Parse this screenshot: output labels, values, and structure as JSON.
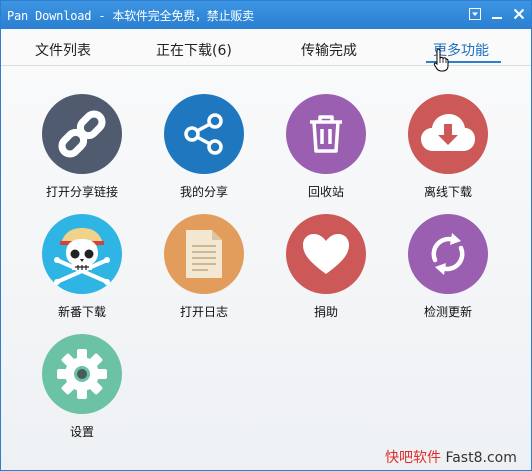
{
  "window": {
    "title": "Pan Download - 本软件完全免费，禁止贩卖"
  },
  "tabs": [
    {
      "label": "文件列表",
      "active": false
    },
    {
      "label": "正在下载(6)",
      "active": false
    },
    {
      "label": "传输完成",
      "active": false
    },
    {
      "label": "更多功能",
      "active": true
    }
  ],
  "features": [
    {
      "label": "打开分享链接",
      "icon": "link-icon",
      "color": "#505b70"
    },
    {
      "label": "我的分享",
      "icon": "share-icon",
      "color": "#1f78bf"
    },
    {
      "label": "回收站",
      "icon": "trash-icon",
      "color": "#9a5fb0"
    },
    {
      "label": "离线下载",
      "icon": "cloud-download-icon",
      "color": "#cc5858"
    },
    {
      "label": "新番下载",
      "icon": "skull-icon",
      "color": "#2fb5e3"
    },
    {
      "label": "打开日志",
      "icon": "document-icon",
      "color": "#e29d5c"
    },
    {
      "label": "捐助",
      "icon": "heart-icon",
      "color": "#cc5858"
    },
    {
      "label": "检测更新",
      "icon": "refresh-icon",
      "color": "#9a5fb0"
    },
    {
      "label": "设置",
      "icon": "gear-icon",
      "color": "#6cc2a4"
    }
  ],
  "watermark": {
    "part1": "快吧软件",
    "part2": " Fast8.com"
  }
}
